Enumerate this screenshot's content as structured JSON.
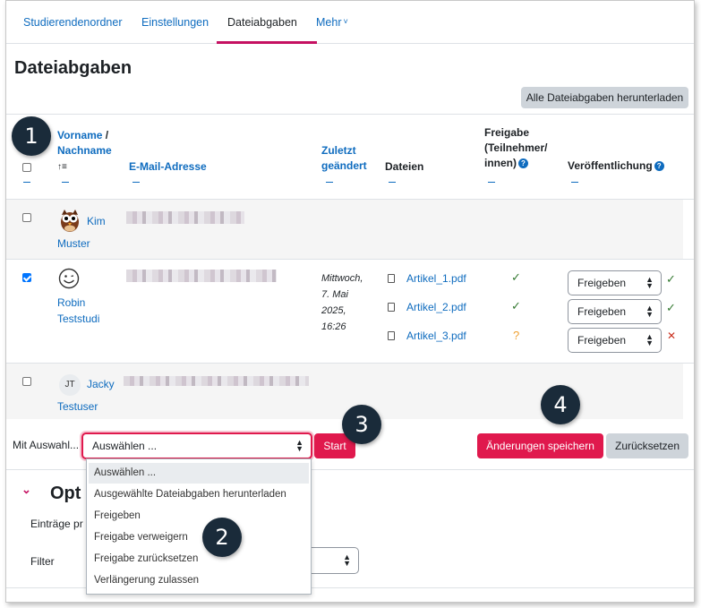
{
  "nav": {
    "items": [
      "Studierendenordner",
      "Einstellungen",
      "Dateiabgaben",
      "Mehr"
    ],
    "more_chevron": "˅"
  },
  "page_title": "Dateiabgaben",
  "download_all_button": "Alle Dateiabgaben herunterladen",
  "table": {
    "headers": {
      "firstname": "Vorname",
      "slash": " /",
      "lastname": "Nachname",
      "sort_icon": "↑≡",
      "email": "E-Mail-Adresse",
      "modified_1": "Zuletzt",
      "modified_2": "geändert",
      "files": "Dateien",
      "approval_1": "Freigabe",
      "approval_2": "(Teilnehmer/",
      "approval_3": "innen)",
      "publication": "Veröffentlichung"
    },
    "rows": [
      {
        "firstname": "Kim",
        "lastname": "Muster",
        "checked": false
      },
      {
        "firstname": "Robin",
        "lastname": "Teststudi",
        "checked": true,
        "modified": [
          "Mittwoch,",
          "7. Mai",
          "2025,",
          "16:26"
        ],
        "files": [
          {
            "name": "Artikel_1.pdf",
            "approval": "✓",
            "publication": "Freigeben",
            "status": "✓"
          },
          {
            "name": "Artikel_2.pdf",
            "approval": "✓",
            "publication": "Freigeben",
            "status": "✓"
          },
          {
            "name": "Artikel_3.pdf",
            "approval": "?",
            "publication": "Freigeben",
            "status": "✕"
          }
        ]
      },
      {
        "initials": "JT",
        "firstname": "Jacky",
        "lastname": "Testuser",
        "checked": false
      }
    ]
  },
  "bulk": {
    "label": "Mit Auswahl...",
    "select_value": "Auswählen ...",
    "start_button": "Start",
    "options": [
      "Auswählen ...",
      "Ausgewählte Dateiabgaben herunterladen",
      "Freigeben",
      "Freigabe verweigern",
      "Freigabe zurücksetzen",
      "Verlängerung zulassen"
    ]
  },
  "save_button": "Änderungen speichern",
  "reset_button": "Zurücksetzen",
  "options_section": {
    "title": "Opt",
    "entries_label": "Einträge pr",
    "filter_label": "Filter"
  },
  "badges": [
    "1",
    "2",
    "3",
    "4"
  ],
  "colors": {
    "accent": "#c51162",
    "primary_button": "#e0194d",
    "link": "#0f6cbf",
    "success": "#357a32",
    "warning": "#f0a030",
    "danger": "#ca3120"
  }
}
